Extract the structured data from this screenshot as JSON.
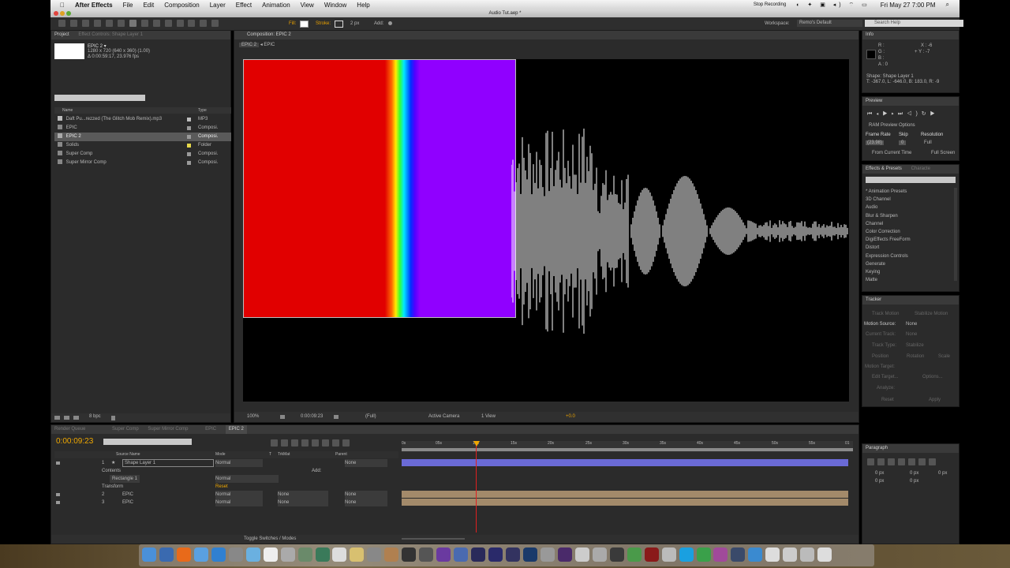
{
  "menubar": {
    "app": "After Effects",
    "items": [
      "File",
      "Edit",
      "Composition",
      "Layer",
      "Effect",
      "Animation",
      "View",
      "Window",
      "Help"
    ],
    "recording": "Stop Recording",
    "clock": "Fri May 27  7:00 PM"
  },
  "window": {
    "title": "Audio Tut.aep *"
  },
  "toolbar": {
    "fill_label": "Fill:",
    "stroke_label": "Stroke:",
    "stroke_width": "2 px",
    "add_label": "Add:",
    "workspace_label": "Workspace:",
    "workspace_value": "Remo's Default",
    "search_placeholder": "Search Help"
  },
  "project": {
    "tab_project": "Project",
    "tab_effect_controls": "Effect Controls: Shape Layer 1",
    "selected_name": "EPIC 2 ▾",
    "selected_info1": "1280 x 720  (640 x 360) (1.00)",
    "selected_info2": "Δ 0:00:59:17, 23.976 fps",
    "col_name": "Name",
    "col_type": "Type",
    "items": [
      {
        "name": "Daft Pu...rezzed (The Glitch Mob Remix).mp3",
        "type": "MP3",
        "color": "#bdbdbd"
      },
      {
        "name": "EPIC",
        "type": "Composi.",
        "color": "#9a9a9a"
      },
      {
        "name": "EPIC 2",
        "type": "Composi.",
        "color": "#9a9a9a"
      },
      {
        "name": "Solids",
        "type": "Folder",
        "color": "#e6d84a"
      },
      {
        "name": "Super Comp",
        "type": "Composi.",
        "color": "#9a9a9a"
      },
      {
        "name": "Super Mirror Comp",
        "type": "Composi.",
        "color": "#9a9a9a"
      }
    ],
    "bpc": "8 bpc"
  },
  "composition": {
    "tab": "Composition: EPIC 2",
    "crumbs": [
      "EPIC 2",
      "EPIC"
    ],
    "zoom": "100%",
    "timecode": "0:00:09:23",
    "resolution": "(Full)",
    "camera": "Active Camera",
    "view": "1 View",
    "exposure": "+0.0"
  },
  "info": {
    "title": "Info",
    "r": "R :",
    "g": "G :",
    "b": "B :",
    "a": "A : 0",
    "x": "X : -6",
    "y": "+ Y : -7",
    "shape": "Shape: Shape Layer 1",
    "coords": "T: -367.0, L: -646.0, B: 183.0, R: -9"
  },
  "preview": {
    "title": "Preview",
    "ram": "RAM Preview Options",
    "frame_rate_label": "Frame Rate",
    "skip_label": "Skip",
    "resolution_label": "Resolution",
    "frame_rate_value": "(23.98)",
    "skip_value": "0",
    "resolution_value": "Full",
    "from_current": "From Current Time",
    "full_screen": "Full Screen"
  },
  "effects": {
    "tab1": "Effects & Presets",
    "tab2": "Characte",
    "items": [
      "* Animation Presets",
      "3D Channel",
      "Audio",
      "Blur & Sharpen",
      "Channel",
      "Color Correction",
      "DigiEffects FreeForm",
      "Distort",
      "Expression Controls",
      "Generate",
      "Keying",
      "Matte"
    ]
  },
  "tracker": {
    "title": "Tracker",
    "track_motion": "Track Motion",
    "stabilize_motion": "Stabilize Motion",
    "motion_source_label": "Motion Source:",
    "motion_source_value": "None",
    "current_track_label": "Current Track:",
    "current_track_value": "None",
    "track_type_label": "Track Type:",
    "track_type_value": "Stabilize",
    "position": "Position",
    "rotation": "Rotation",
    "scale": "Scale",
    "motion_target": "Motion Target:",
    "edit_target": "Edit Target...",
    "options": "Options...",
    "analyze": "Analyze:",
    "reset": "Reset",
    "apply": "Apply"
  },
  "paragraph": {
    "title": "Paragraph",
    "v1": "0 px",
    "v2": "0 px",
    "v3": "0 px",
    "v4": "0 px",
    "v5": "0 px"
  },
  "timeline": {
    "tabs": [
      "Render Queue",
      "Super Comp",
      "Super Mirror Comp",
      "EPIC",
      "EPIC 2"
    ],
    "timecode": "0:00:09:23",
    "col_source": "Source Name",
    "col_mode": "Mode",
    "col_t": "T",
    "col_trkmat": "TrkMat",
    "col_parent": "Parent",
    "layers": [
      {
        "num": "1",
        "name": "Shape Layer 1",
        "mode": "Normal",
        "trkmat": "",
        "parent": "None"
      },
      {
        "num": "2",
        "name": "EPIC",
        "mode": "Normal",
        "trkmat": "None",
        "parent": "None"
      },
      {
        "num": "3",
        "name": "EPIC",
        "mode": "Normal",
        "trkmat": "None",
        "parent": "None"
      }
    ],
    "contents": "Contents",
    "add_label": "Add:",
    "rectangle": "Rectangle 1",
    "rect_mode": "Normal",
    "transform": "Transform",
    "reset": "Reset",
    "ruler": [
      "0s",
      "05s",
      "10s",
      "15s",
      "20s",
      "25s",
      "30s",
      "35s",
      "40s",
      "45s",
      "50s",
      "55s",
      "01"
    ],
    "toggle": "Toggle Switches / Modes",
    "accent": "#f0a800"
  },
  "colors": {
    "red": "#e10000",
    "violet": "#9000ff",
    "layer_bar": "#6a6ad6",
    "tan_bar": "#a38a6a"
  }
}
